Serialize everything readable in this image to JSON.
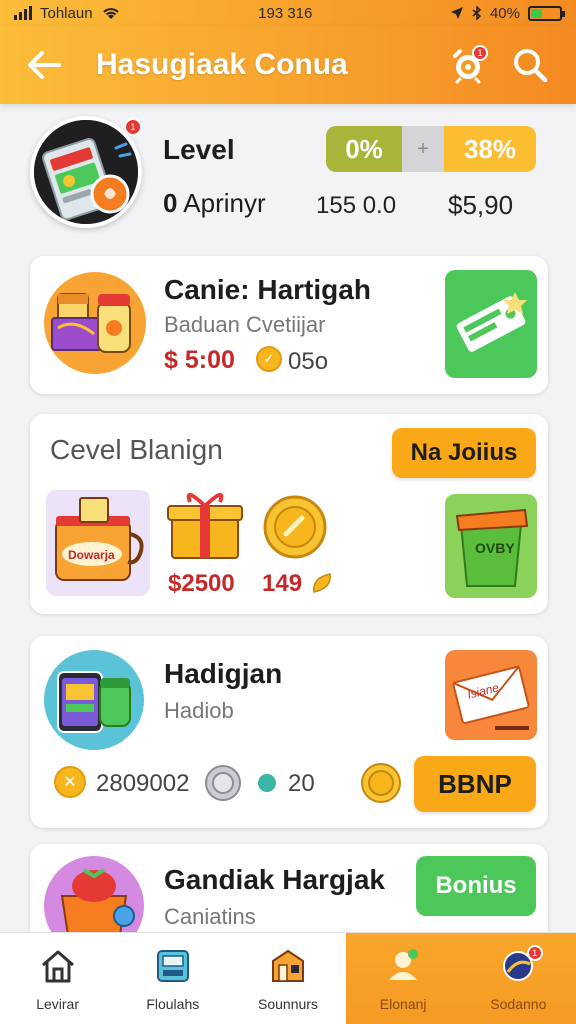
{
  "status_bar": {
    "carrier": "Tohlaun",
    "time": "193 316",
    "battery": "40%",
    "battery_level": 0.4
  },
  "app_bar": {
    "title": "Hasugiaak Conua",
    "back_icon": "arrow-left-icon",
    "notif_icon": "alarm-icon",
    "notif_badge": "1",
    "search_icon": "search-icon"
  },
  "level": {
    "avatar_badge": "1",
    "title": "Level",
    "subtitle_num": "0",
    "subtitle_text": "Aprinyr",
    "pill_left": "0%",
    "pill_mid": "+",
    "pill_right": "38%",
    "value_a": "155 0.0",
    "value_b": "$5,90"
  },
  "card1": {
    "title": "Canie: Hartigah",
    "subtitle": "Baduan Cvetiijar",
    "price": "$ 5:00",
    "coin_value": "05o"
  },
  "card2": {
    "title": "Cevel Blanign",
    "button": "Na Joiius",
    "mug_text": "Dowarja",
    "price": "$2500",
    "count": "149",
    "bag_text": "OVBY"
  },
  "card3": {
    "title": "Hadigjan",
    "subtitle": "Hadiob",
    "stat1": "2809002",
    "stat2": "20",
    "envelope_text": "Isiane",
    "button": "BBNP"
  },
  "card4": {
    "title": "Gandiak Hargjak",
    "subtitle": "Caniatins",
    "button": "Bonius"
  },
  "nav": {
    "items": [
      {
        "label": "Levirar",
        "icon": "home-icon"
      },
      {
        "label": "Floulahs",
        "icon": "inbox-icon"
      },
      {
        "label": "Sounnurs",
        "icon": "store-icon"
      },
      {
        "label": "Elonanj",
        "icon": "profile-icon"
      },
      {
        "label": "Sodanno",
        "icon": "planet-icon",
        "badge": "1"
      }
    ],
    "active_index": 3
  },
  "colors": {
    "header_orange": "#f7a22d",
    "accent_green": "#4cc85a",
    "accent_orange": "#f9a818",
    "price_red": "#c62828"
  }
}
